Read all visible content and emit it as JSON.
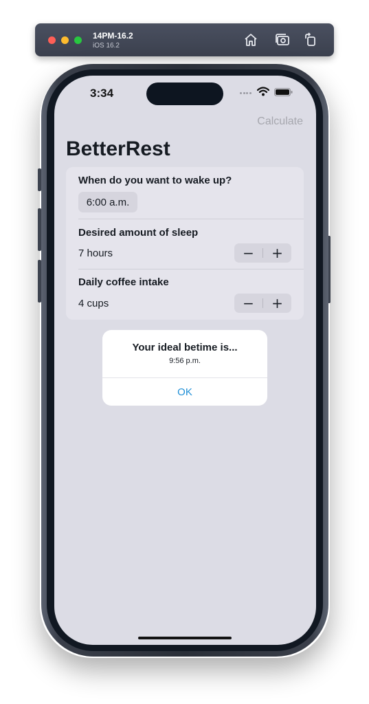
{
  "simulator": {
    "device_name": "14PM-16.2",
    "os_version": "iOS 16.2",
    "toolbar_icons": [
      "home-icon",
      "screenshot-icon",
      "rotate-icon"
    ]
  },
  "status_bar": {
    "time": "3:34",
    "icons": [
      "cellular-signal-icon",
      "wifi-icon",
      "battery-icon"
    ]
  },
  "nav": {
    "calculate_label": "Calculate",
    "title": "BetterRest"
  },
  "form": {
    "wake": {
      "heading": "When do you want to wake up?",
      "value": "6:00 a.m."
    },
    "sleep": {
      "heading": "Desired amount of sleep",
      "value": "7 hours",
      "minus": "−",
      "plus": "+"
    },
    "coffee": {
      "heading": "Daily coffee intake",
      "value": "4 cups",
      "minus": "−",
      "plus": "+"
    }
  },
  "alert": {
    "title": "Your ideal betime is...",
    "message": "9:56 p.m.",
    "ok_label": "OK"
  },
  "colors": {
    "screen_background": "#dcdce5",
    "card_background": "#e5e4ec",
    "accent": "#1f8fd6",
    "disabled_text": "#a6a7ae"
  }
}
